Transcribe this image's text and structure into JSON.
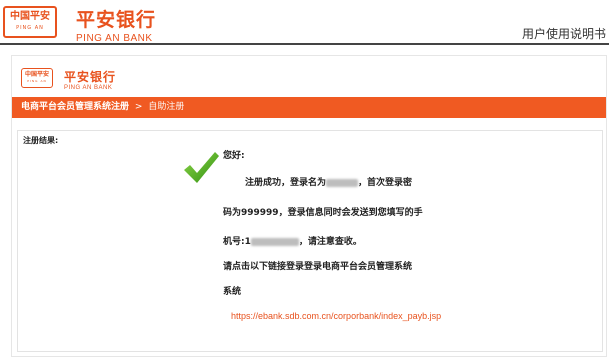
{
  "doc_header": {
    "logo_cn": "中国平安",
    "logo_en": "PING AN",
    "brand_cn": "平安银行",
    "brand_en": "PING AN BANK",
    "title": "用户使用说明书"
  },
  "app": {
    "logo_cn": "中国平安",
    "logo_en": "PING AN",
    "brand_cn": "平安银行",
    "brand_en": "PING AN BANK",
    "breadcrumb": {
      "parent": "电商平台会员管理系统注册",
      "separator": ">",
      "current": "自助注册"
    },
    "result": {
      "label": "注册结果:",
      "greeting": "您好:",
      "line1_prefix": "注册成功，登录名为",
      "line1_suffix": "，首次登录密",
      "line2": "码为999999，登录信息同时会发送到您填写的手",
      "line3_prefix": "机号:1",
      "line3_suffix": "，请注意查收。",
      "line4": "请点击以下链接登录登录电商平台会员管理系统",
      "line5": "系统",
      "link": "https://ebank.sdb.com.cn/corporbank/index_payb.jsp"
    }
  },
  "colors": {
    "brand_orange": "#e8521e",
    "nav_orange": "#f05a22",
    "check_green": "#4caf1a"
  },
  "icons": {
    "check": "check-icon"
  }
}
